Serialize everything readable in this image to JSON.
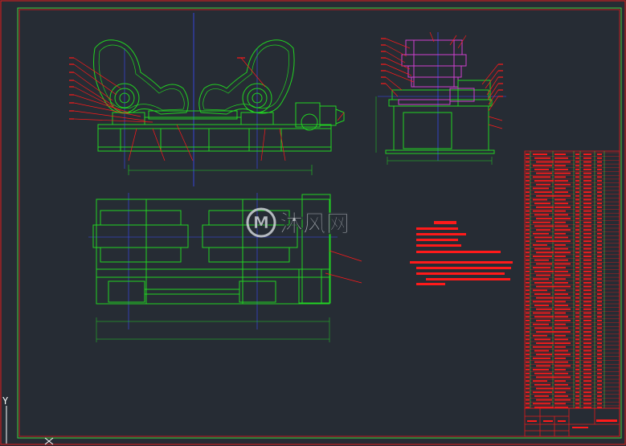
{
  "watermark": {
    "text": "沐风网",
    "logo_letter": "M"
  },
  "ucs": {
    "y_label": "Y"
  },
  "colors": {
    "background": "#262c34",
    "frame_red": "#e41b1b",
    "frame_green": "#3fd23f",
    "drawing_green": "#22d422",
    "centerline_blue": "#3a4cff",
    "text_red": "#ff1a1a",
    "part_magenta": "#d040d0",
    "watermark": "#cfd3d8"
  }
}
